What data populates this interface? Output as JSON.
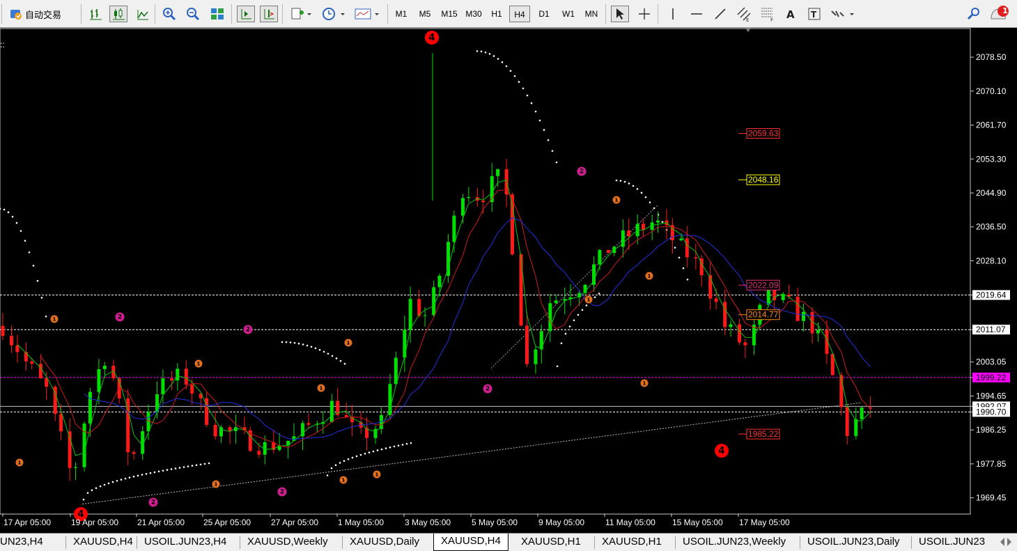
{
  "toolbar": {
    "autotrade_label": "自动交易",
    "timeframes": [
      "M1",
      "M5",
      "M15",
      "M30",
      "H1",
      "H4",
      "D1",
      "W1",
      "MN"
    ],
    "active_timeframe": "H4",
    "notification_count": "1"
  },
  "chart": {
    "symbol": "XAUUSD",
    "timeframe": "H4",
    "price_scale": [
      "2078.50",
      "2070.10",
      "2061.70",
      "2053.30",
      "2044.90",
      "2036.50",
      "2028.10",
      "2019.64",
      "2011.07",
      "2003.05",
      "1999.22",
      "1994.65",
      "1992.07",
      "1990.70",
      "1986.25",
      "1977.85",
      "1969.45"
    ],
    "time_scale": [
      "17 Apr 05:00",
      "19 Apr 05:00",
      "21 Apr 05:00",
      "25 Apr 05:00",
      "27 Apr 05:00",
      "1 May 05:00",
      "3 May 05:00",
      "5 May 05:00",
      "9 May 05:00",
      "11 May 05:00",
      "15 May 05:00",
      "17 May 05:00"
    ],
    "level_labels": [
      {
        "text": "2059.63",
        "color": "#ff3030"
      },
      {
        "text": "2048.16",
        "color": "#ffff00"
      },
      {
        "text": "2022.09",
        "color": "#e0307a"
      },
      {
        "text": "2014.77",
        "color": "#ff8c1a"
      },
      {
        "text": "1985.22",
        "color": "#ff3030"
      }
    ],
    "wave_markers": [
      {
        "text": "4",
        "color": "#ff0000"
      },
      {
        "text": "4",
        "color": "#ff0000"
      },
      {
        "text": "2",
        "color": "#d01f8f"
      },
      {
        "text": "1",
        "color": "#e07020"
      }
    ]
  },
  "tabs": [
    "UN23,H4",
    "XAUUSD,H4",
    "USOIL.JUN23,H4",
    "XAUUSD,Weekly",
    "XAUUSD,Daily",
    "XAUUSD,H4",
    "XAUUSD,H1",
    "XAUUSD,H1",
    "USOIL.JUN23,Weekly",
    "USOIL.JUN23,Daily",
    "USOIL.JUN23"
  ],
  "active_tab_index": 5,
  "colors": {
    "bull": "#00e000",
    "bear": "#ff1a1a",
    "grid": "#ffffff",
    "ma_fast": "#00c800",
    "ma_mid": "#d01818",
    "ma_slow": "#2030e0"
  }
}
